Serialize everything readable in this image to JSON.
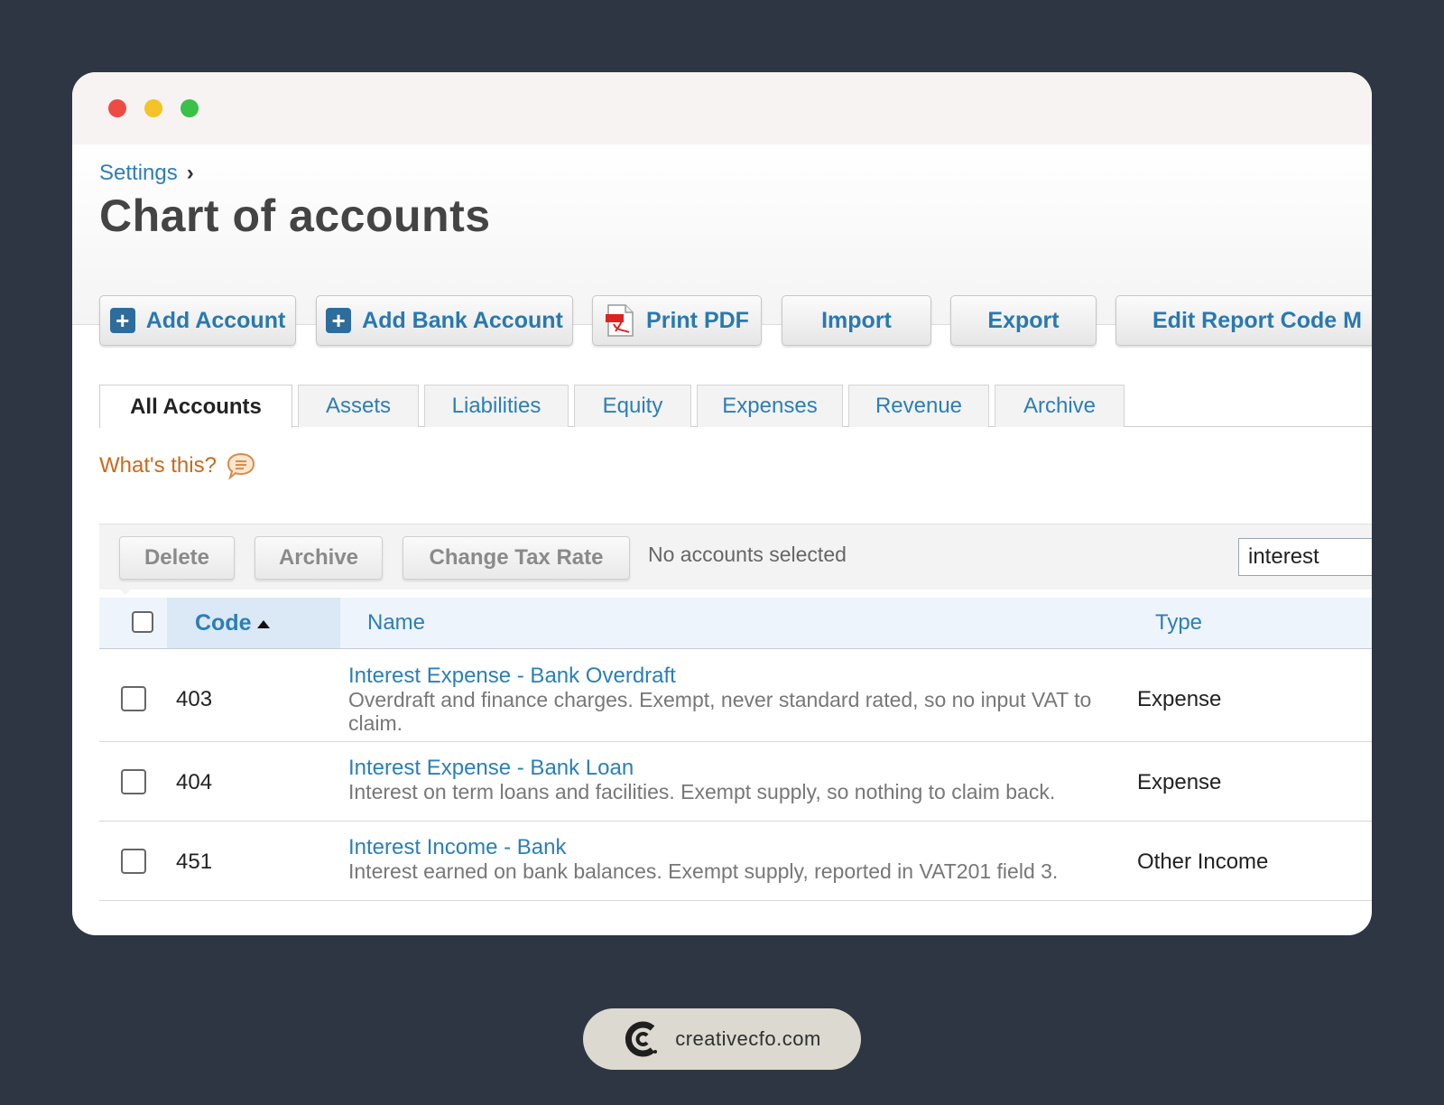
{
  "breadcrumb": {
    "parent": "Settings",
    "separator": "›"
  },
  "page_title": "Chart of accounts",
  "toolbar": {
    "add_account": "Add Account",
    "add_bank_account": "Add Bank Account",
    "print_pdf": "Print PDF",
    "import": "Import",
    "export": "Export",
    "edit_report_code": "Edit Report Code M"
  },
  "tabs": [
    {
      "label": "All Accounts",
      "active": true
    },
    {
      "label": "Assets"
    },
    {
      "label": "Liabilities"
    },
    {
      "label": "Equity"
    },
    {
      "label": "Expenses"
    },
    {
      "label": "Revenue"
    },
    {
      "label": "Archive"
    }
  ],
  "help_link": "What's this?",
  "actions": {
    "delete": "Delete",
    "archive": "Archive",
    "change_tax_rate": "Change Tax Rate",
    "status": "No accounts selected"
  },
  "search": {
    "value": "interest"
  },
  "table": {
    "headers": {
      "code": "Code",
      "name": "Name",
      "type": "Type"
    },
    "sort": {
      "column": "Code",
      "direction": "ascending"
    },
    "rows": [
      {
        "code": "403",
        "name": "Interest Expense - Bank Overdraft",
        "description": "Overdraft and finance charges. Exempt, never standard rated, so no input VAT to claim.",
        "type": "Expense"
      },
      {
        "code": "404",
        "name": "Interest Expense - Bank Loan",
        "description": "Interest on term loans and facilities. Exempt supply, so nothing to claim back.",
        "type": "Expense"
      },
      {
        "code": "451",
        "name": "Interest Income - Bank",
        "description": "Interest earned on bank balances. Exempt supply, reported in VAT201 field 3.",
        "type": "Other Income"
      }
    ]
  },
  "footer": {
    "brand": "creativecfo.com"
  },
  "colors": {
    "background": "#2d3642",
    "link": "#2b7fb6",
    "help": "#c96a1b",
    "window_dot_red": "#ee4b45",
    "window_dot_yellow": "#f5c327",
    "window_dot_green": "#39c14a"
  }
}
